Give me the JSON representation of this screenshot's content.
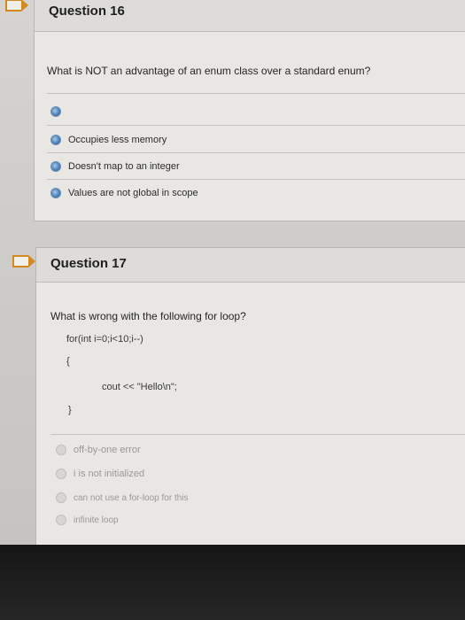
{
  "q16": {
    "title": "Question 16",
    "prompt": "What is NOT an advantage of an enum class over a standard enum?",
    "options": [
      "Occupies less memory",
      "Doesn't map to an integer",
      "Values are not global in scope"
    ]
  },
  "q17": {
    "title": "Question 17",
    "prompt": "What is wrong with the following for loop?",
    "code": [
      "for(int i=0;i<10;i--)",
      "{",
      "cout << \"Hello\\n\";",
      "}"
    ],
    "options": [
      "off-by-one error",
      "i is not initialized",
      "can not use a for-loop for this",
      "infinite loop"
    ]
  },
  "colors": {
    "flag": "#d2891f",
    "radio": "#4f82b8"
  }
}
